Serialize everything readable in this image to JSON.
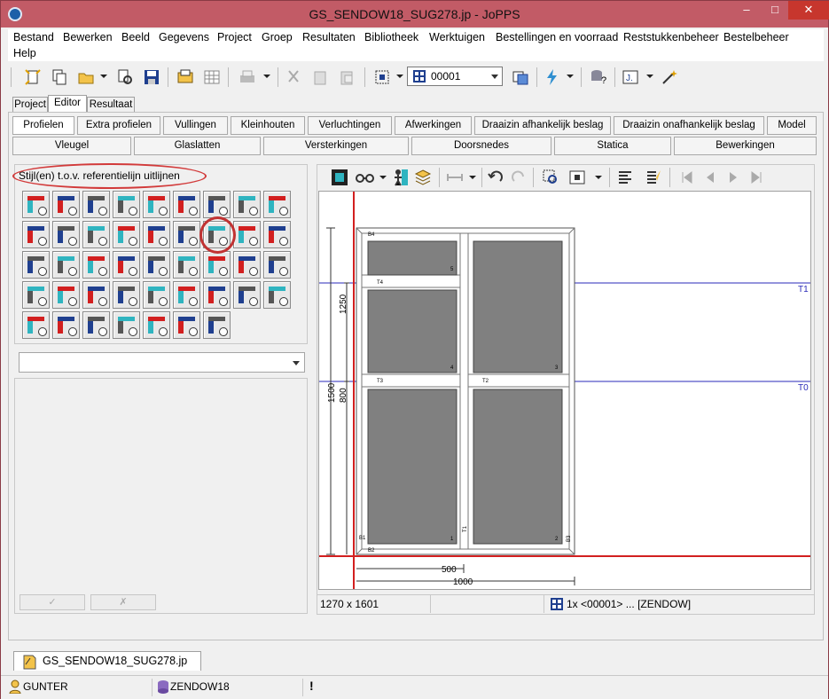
{
  "window": {
    "title": "GS_SENDOW18_SUG278.jp - JoPPS",
    "min_label": "–",
    "max_label": "□",
    "close_label": "✕"
  },
  "menu": [
    "Bestand",
    "Bewerken",
    "Beeld",
    "Gegevens",
    "Project",
    "Groep",
    "Resultaten",
    "Bibliotheek",
    "Werktuigen",
    "Bestellingen en voorraad",
    "Reststukkenbeheer",
    "Bestelbeheer",
    "Help"
  ],
  "toolbar": {
    "combo_value": "00001"
  },
  "outer_tabs": [
    "Project",
    "Editor",
    "Resultaat"
  ],
  "tabs_row1": [
    "Profielen",
    "Extra profielen",
    "Vullingen",
    "Kleinhouten",
    "Verluchtingen",
    "Afwerkingen",
    "Draaizin afhankelijk beslag",
    "Draaizin onafhankelijk beslag",
    "Model"
  ],
  "tabs_row2": [
    "Vleugel",
    "Glaslatten",
    "Versterkingen",
    "Doorsnedes",
    "Statica",
    "Bewerkingen"
  ],
  "tool_panel": {
    "header": "Stijl(en) t.o.v. referentielijn uitlijnen"
  },
  "drawing": {
    "labels_small": [
      "B4",
      "T4",
      "T3",
      "T2",
      "T1",
      "B1",
      "B2",
      "B3"
    ],
    "glass_numbers": [
      "5",
      "4",
      "3",
      "1",
      "2"
    ],
    "ref_lines": [
      "T1",
      "T0"
    ],
    "dims": {
      "d1250": "1250",
      "d1500": "1500",
      "d800": "800",
      "d500": "500",
      "d1000": "1000"
    }
  },
  "status": {
    "size": "1270 x 1601",
    "info": "1x <00001> ... [ZENDOW]"
  },
  "doc_tab": {
    "label": "GS_SENDOW18_SUG278.jp"
  },
  "bottombar": {
    "user": "GUNTER",
    "db": "ZENDOW18",
    "alert": "!"
  }
}
